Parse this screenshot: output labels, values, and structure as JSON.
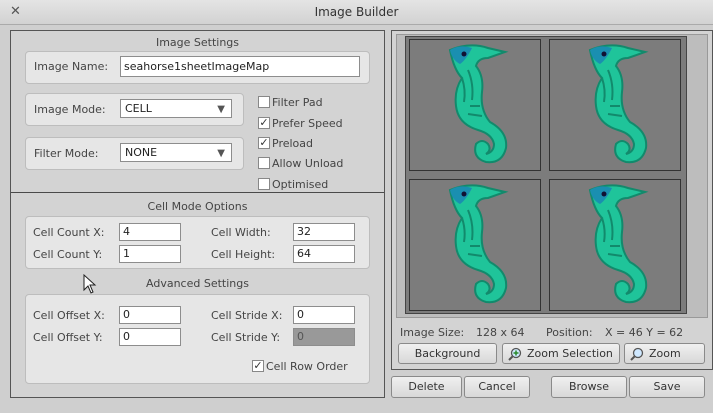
{
  "window": {
    "title": "Image Builder"
  },
  "image_settings": {
    "title": "Image Settings",
    "image_name_label": "Image Name:",
    "image_name_value": "seahorse1sheetImageMap",
    "image_mode_label": "Image Mode:",
    "image_mode_value": "CELL",
    "filter_mode_label": "Filter Mode:",
    "filter_mode_value": "NONE",
    "checkboxes": {
      "filter_pad": {
        "label": "Filter Pad",
        "checked": false
      },
      "prefer_speed": {
        "label": "Prefer Speed",
        "checked": true
      },
      "preload": {
        "label": "Preload",
        "checked": true
      },
      "allow_unload": {
        "label": "Allow Unload",
        "checked": false
      },
      "optimised": {
        "label": "Optimised",
        "checked": false
      }
    }
  },
  "cell_mode": {
    "title": "Cell Mode Options",
    "count_x_label": "Cell Count X:",
    "count_x": "4",
    "count_y_label": "Cell Count Y:",
    "count_y": "1",
    "width_label": "Cell Width:",
    "width": "32",
    "height_label": "Cell Height:",
    "height": "64"
  },
  "advanced": {
    "title": "Advanced Settings",
    "offset_x_label": "Cell Offset X:",
    "offset_x": "0",
    "offset_y_label": "Cell Offset Y:",
    "offset_y": "0",
    "stride_x_label": "Cell Stride X:",
    "stride_x": "0",
    "stride_y_label": "Cell Stride Y:",
    "stride_y": "0",
    "row_order_label": "Cell Row Order",
    "row_order_checked": true
  },
  "preview": {
    "image_size_label": "Image Size:",
    "image_size": "128 x 64",
    "position_label": "Position:",
    "position": "X = 46  Y = 62",
    "background_button": "Background",
    "zoom_selection_button": "Zoom Selection",
    "zoom_button": "Zoom"
  },
  "footer": {
    "delete": "Delete",
    "cancel": "Cancel",
    "browse": "Browse",
    "save": "Save"
  },
  "colors": {
    "seahorse": "#1fc49a",
    "seahorse_dark": "#128a6c",
    "seahorse_head": "#1a8fb0",
    "tile_bg": "#7c7c7c"
  },
  "icons": {
    "close": "close-icon",
    "zoom_selection": "zoom-plus-icon",
    "zoom": "magnifier-icon"
  }
}
